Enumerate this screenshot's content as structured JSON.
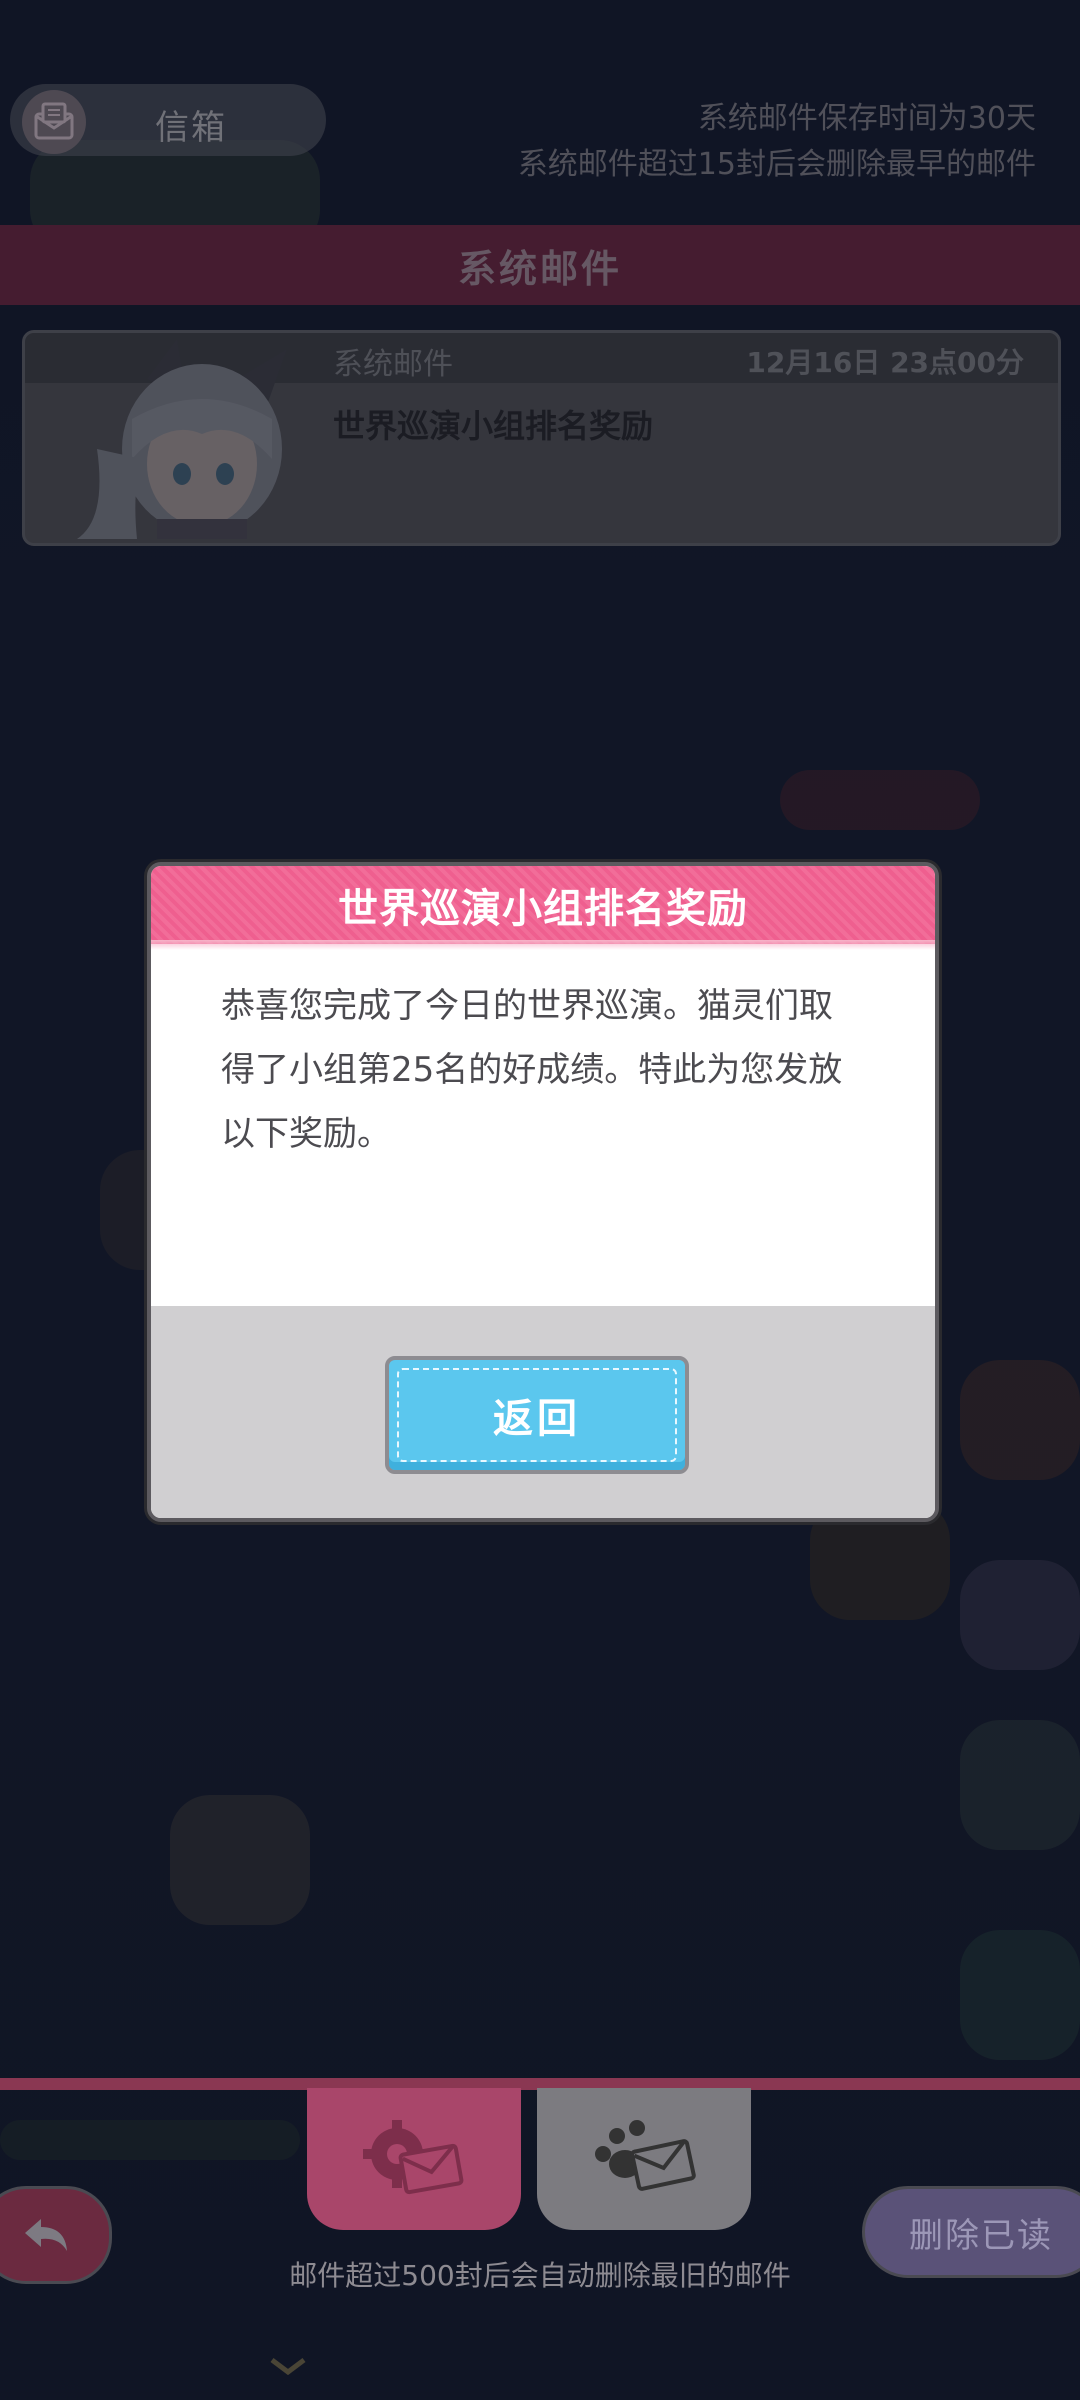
{
  "header": {
    "mailbox_title": "信箱",
    "retention_line1": "系统邮件保存时间为30天",
    "retention_line2": "系统邮件超过15封后会删除最早的邮件",
    "mailbox_icon": "envelope-icon"
  },
  "section": {
    "title": "系统邮件"
  },
  "mail_list": [
    {
      "sender": "系统邮件",
      "date": "12月16日 23点00分",
      "subject": "世界巡演小组排名奖励"
    }
  ],
  "dialog": {
    "title": "世界巡演小组排名奖励",
    "body": "恭喜您完成了今日的世界巡演。猫灵们取得了小组第25名的好成绩。特此为您发放以下奖励。",
    "back_button": "返回"
  },
  "bottom": {
    "tabs": [
      {
        "icon": "gear-envelope-icon",
        "selected": true
      },
      {
        "icon": "paw-envelope-icon",
        "selected": false
      }
    ],
    "back_icon": "back-arrow-icon",
    "delete_read_label": "删除已读",
    "limit_note": "邮件超过500封后会自动删除最旧的邮件"
  },
  "colors": {
    "accent_pink": "#f26d99",
    "section_bar": "#7b2c47",
    "button_blue": "#5bc7ee"
  }
}
